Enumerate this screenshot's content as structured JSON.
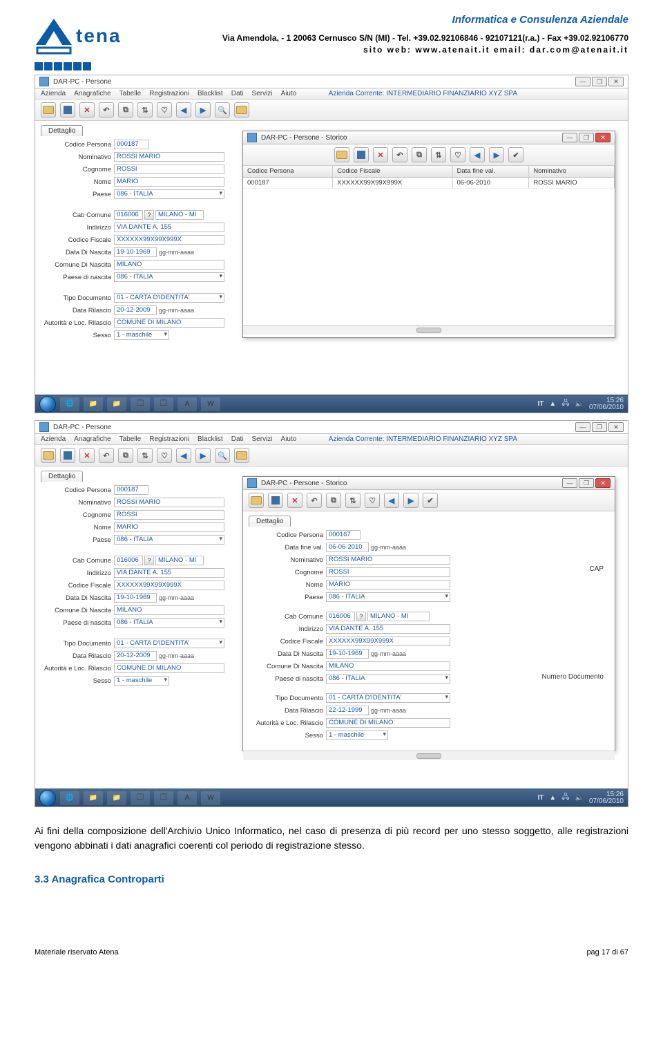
{
  "header": {
    "brand": "tena",
    "slogan": "Informatica e Consulenza Aziendale",
    "address": "Via Amendola, - 1 20063 Cernusco S/N (MI) - Tel. +39.02.92106846 - 92107121(r.a.) - Fax +39.02.92106770",
    "web": "sito web: www.atenait.it      email: dar.com@atenait.it"
  },
  "menus": [
    "Azienda",
    "Anagrafiche",
    "Tabelle",
    "Registrazioni",
    "Blacklist",
    "Dati",
    "Servizi",
    "Aiuto"
  ],
  "window_title": "DAR-PC - Persone",
  "azienda_corrente": "Azienda Corrente: INTERMEDIARIO FINANZIARIO XYZ SPA",
  "section_tab": "Dettaglio",
  "form_labels": {
    "codice_persona": "Codice Persona",
    "nominativo": "Nominativo",
    "cognome": "Cognome",
    "nome": "Nome",
    "paese": "Paese",
    "cab_comune": "Cab Comune",
    "indirizzo": "Indirizzo",
    "codice_fiscale": "Codice Fiscale",
    "data_nascita": "Data Di Nascita",
    "comune_nascita": "Comune Di Nascita",
    "paese_nascita": "Paese di nascita",
    "tipo_documento": "Tipo Documento",
    "data_rilascio": "Data Rilascio",
    "autorita_rilascio": "Autorità e Loc. Rilascio",
    "sesso": "Sesso",
    "data_fine_val": "Data fine val.",
    "cap": "CAP",
    "numero_documento": "Numero Documento"
  },
  "form_values": {
    "codice_persona": "000187",
    "nominativo": "ROSSI MARIO",
    "cognome": "ROSSI",
    "nome": "MARIO",
    "paese": "086 - ITALIA",
    "cab_comune": "016006",
    "cab_comune_desc": "MILANO - MI",
    "indirizzo": "VIA DANTE A. 155",
    "codice_fiscale": "XXXXXX99X99X999X",
    "data_nascita": "19-10-1969",
    "comune_nascita": "MILANO",
    "paese_nascita": "086 - ITALIA",
    "tipo_documento": "01 - CARTA D'IDENTITA'",
    "data_rilascio": "20-12-2009",
    "autorita_rilascio": "COMUNE DI MILANO",
    "sesso": "1 - maschile",
    "date_hint": "gg-mm-aaaa"
  },
  "storico": {
    "title": "DAR-PC - Persone - Storico",
    "columns": [
      "Codice Persona",
      "Codice Fiscale",
      "Data fine val.",
      "Nominativo"
    ],
    "row": {
      "codice_persona": "000187",
      "codice_fiscale": "XXXXXX99X99X999X",
      "data_fine_val": "06-06-2010",
      "nominativo": "ROSSI MARIO"
    },
    "detail": {
      "codice_persona": "000167",
      "data_fine_val": "06-06-2010",
      "nominativo": "ROSSI MARIO",
      "cognome": "ROSSI",
      "nome": "MARIO",
      "paese": "086 - ITALIA",
      "cab_comune": "016006",
      "cab_comune_desc": "MILANO - MI",
      "indirizzo": "VIA DANTE A. 155",
      "codice_fiscale": "XXXXXX99X99X999X",
      "data_nascita": "19-10-1969",
      "comune_nascita": "MILANO",
      "paese_nascita": "086 - ITALIA",
      "tipo_documento": "01 - CARTA D'IDENTITA'",
      "data_rilascio": "22-12-1999",
      "autorita_rilascio": "COMUNE DI MILANO",
      "sesso": "1 - maschile"
    }
  },
  "tray": {
    "lang": "IT",
    "time": "15:26",
    "date": "07/06/2010"
  },
  "doc": {
    "para": "Ai fini della composizione dell'Archivio Unico Informatico, nel caso di presenza di più record per uno stesso soggetto, alle registrazioni vengono abbinati i dati anagrafici coerenti col periodo di registrazione stesso.",
    "h3": "3.3 Anagrafica Controparti",
    "footer_left": "Materiale riservato Atena",
    "footer_right": "pag 17 di 67"
  }
}
